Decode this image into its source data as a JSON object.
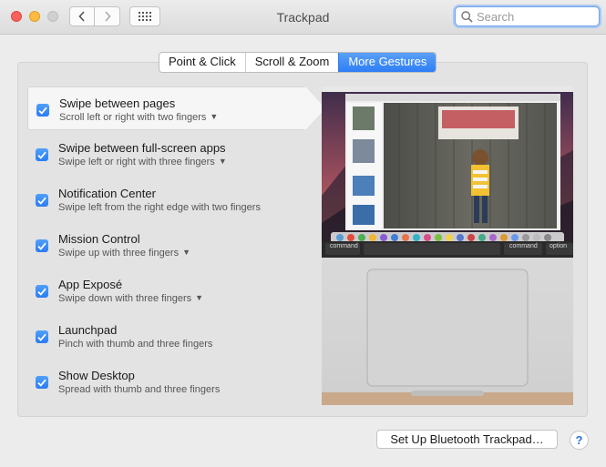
{
  "window": {
    "title": "Trackpad"
  },
  "search": {
    "placeholder": "Search"
  },
  "tabs": [
    {
      "label": "Point & Click",
      "active": false
    },
    {
      "label": "Scroll & Zoom",
      "active": false
    },
    {
      "label": "More Gestures",
      "active": true
    }
  ],
  "gestures": [
    {
      "title": "Swipe between pages",
      "subtitle": "Scroll left or right with two fingers",
      "checked": true,
      "has_menu": true,
      "selected": true
    },
    {
      "title": "Swipe between full-screen apps",
      "subtitle": "Swipe left or right with three fingers",
      "checked": true,
      "has_menu": true
    },
    {
      "title": "Notification Center",
      "subtitle": "Swipe left from the right edge with two fingers",
      "checked": true,
      "has_menu": false
    },
    {
      "title": "Mission Control",
      "subtitle": "Swipe up with three fingers",
      "checked": true,
      "has_menu": true
    },
    {
      "title": "App Exposé",
      "subtitle": "Swipe down with three fingers",
      "checked": true,
      "has_menu": true
    },
    {
      "title": "Launchpad",
      "subtitle": "Pinch with thumb and three fingers",
      "checked": true,
      "has_menu": false
    },
    {
      "title": "Show Desktop",
      "subtitle": "Spread with thumb and three fingers",
      "checked": true,
      "has_menu": false
    }
  ],
  "preview": {
    "keys": {
      "left_command": "command",
      "right_command": "command",
      "right_option": "option"
    }
  },
  "buttons": {
    "setup_bluetooth": "Set Up Bluetooth Trackpad…",
    "help": "?"
  },
  "colors": {
    "accent": "#2e7ef5",
    "checkbox": "#3b8cf6"
  }
}
